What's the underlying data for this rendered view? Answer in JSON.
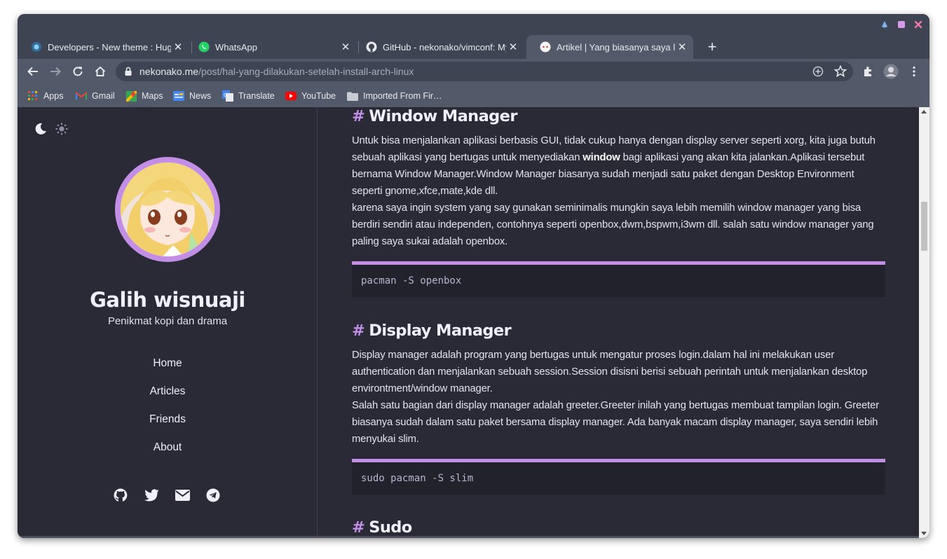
{
  "browser": {
    "tabs": [
      {
        "title": "Developers - New theme : Hugo",
        "favicon": "hugo-icon"
      },
      {
        "title": "WhatsApp",
        "favicon": "whatsapp-icon"
      },
      {
        "title": "GitHub - nekonako/vimconf: My",
        "favicon": "github-icon"
      },
      {
        "title": "Artikel | Yang biasanya saya laku",
        "favicon": "site-icon",
        "active": true
      }
    ],
    "tab_close": "✕",
    "new_tab": "+",
    "url_host": "nekonako.me",
    "url_path": "/post/hal-yang-dilakukan-setelah-install-arch-linux",
    "bookmarks": [
      {
        "label": "Apps",
        "icon": "apps-grid-icon"
      },
      {
        "label": "Gmail",
        "icon": "gmail-icon"
      },
      {
        "label": "Maps",
        "icon": "maps-icon"
      },
      {
        "label": "News",
        "icon": "news-icon"
      },
      {
        "label": "Translate",
        "icon": "translate-icon"
      },
      {
        "label": "YouTube",
        "icon": "youtube-icon"
      },
      {
        "label": "Imported From Fir…",
        "icon": "folder-icon"
      }
    ],
    "colors": {
      "frame": "#3e4452",
      "toolbar": "#525a69"
    }
  },
  "sidebar": {
    "name": "Galih wisnuaji",
    "bio": "Penikmat kopi dan drama",
    "nav": [
      "Home",
      "Articles",
      "Friends",
      "About"
    ],
    "socials": [
      "github-icon",
      "twitter-icon",
      "mail-icon",
      "telegram-icon"
    ]
  },
  "article": {
    "hash": "#",
    "sections": [
      {
        "heading": "Window Manager",
        "p1_before": "Untuk bisa menjalankan aplikasi berbasis GUI, tidak cukup hanya dengan display server seperti xorg, kita juga butuh sebuah aplikasi yang bertugas untuk menyediakan ",
        "p1_bold": "window",
        "p1_after": " bagi aplikasi yang akan kita jalankan.Aplikasi tersebut bernama Window Manager.Window Manager biasanya sudah menjadi satu paket dengan Desktop Environment seperti gnome,xfce,mate,kde dll.",
        "p2": "karena saya ingin system yang say gunakan seminimalis mungkin saya lebih memilih window manager yang bisa berdiri sendiri atau independen, contohnya seperti openbox,dwm,bspwm,i3wm dll. salah satu window manager yang paling saya sukai adalah openbox.",
        "code": "pacman -S openbox"
      },
      {
        "heading": "Display Manager",
        "p1": "Display manager adalah program yang bertugas untuk mengatur proses login.dalam hal ini melakukan user authentication dan menjalankan sebuah session.Session disisni berisi sebuah perintah untuk menjalankan desktop environtment/window manager.",
        "p2": "Salah satu bagian dari display manager adalah greeter.Greeter inilah yang bertugas membuat tampilan login. Greeter biasanya sudah dalam satu paket bersama display manager. Ada banyak macam display manager, saya sendiri lebih menyukai slim.",
        "code": "sudo pacman -S slim"
      },
      {
        "heading": "Sudo"
      }
    ],
    "colors": {
      "accent": "#c38ee6",
      "background": "#292a36",
      "code_bg": "#21222c"
    }
  }
}
